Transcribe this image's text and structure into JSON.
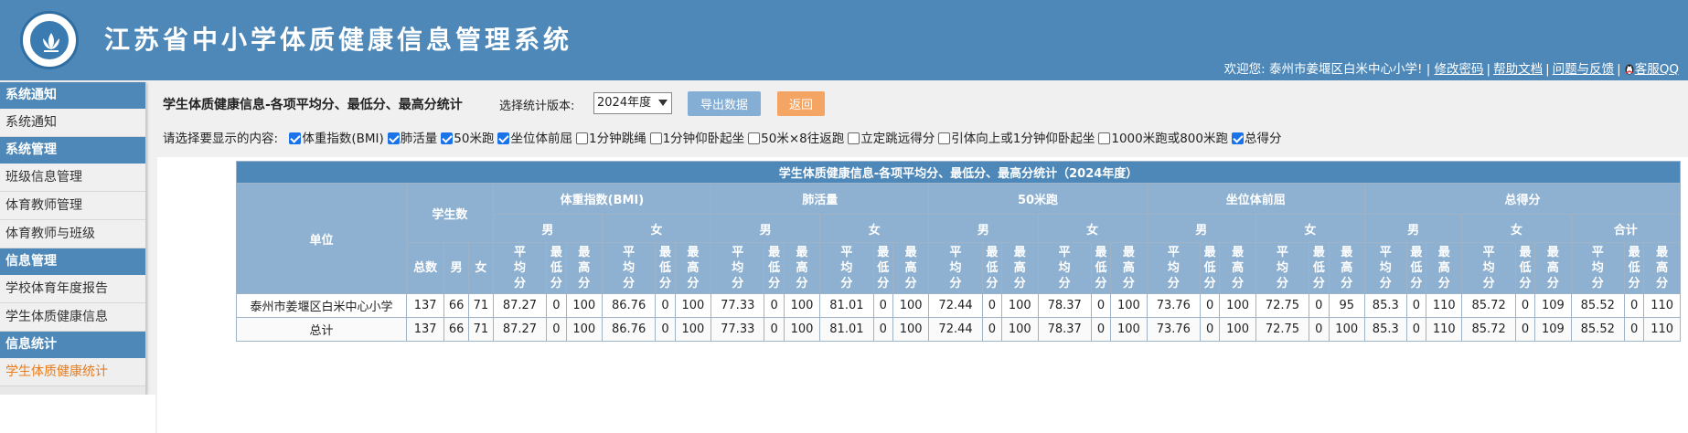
{
  "header": {
    "title": "江苏省中小学体质健康信息管理系统"
  },
  "topnav": {
    "welcome": "欢迎您: 泰州市姜堰区白米中心小学! |",
    "change_password": "修改密码",
    "help": "帮助文档",
    "feedback": "问题与反馈",
    "qq": "客服QQ"
  },
  "sidebar": [
    {
      "head": "系统通知",
      "items": [
        {
          "label": "系统通知"
        }
      ]
    },
    {
      "head": "系统管理",
      "items": [
        {
          "label": "班级信息管理"
        },
        {
          "label": "体育教师管理"
        },
        {
          "label": "体育教师与班级"
        }
      ]
    },
    {
      "head": "信息管理",
      "items": [
        {
          "label": "学校体育年度报告"
        },
        {
          "label": "学生体质健康信息"
        }
      ]
    },
    {
      "head": "信息统计",
      "items": [
        {
          "label": "学生体质健康统计",
          "active": true
        }
      ]
    }
  ],
  "toolbar": {
    "page_title": "学生体质健康信息-各项平均分、最低分、最高分统计",
    "version_label": "选择统计版本:",
    "version_value": "2024年度",
    "export_label": "导出数据",
    "back_label": "返回"
  },
  "options": {
    "label": "请选择要显示的内容:",
    "items": [
      {
        "label": "体重指数(BMI)",
        "checked": true
      },
      {
        "label": "肺活量",
        "checked": true
      },
      {
        "label": "50米跑",
        "checked": true
      },
      {
        "label": "坐位体前屈",
        "checked": true
      },
      {
        "label": "1分钟跳绳",
        "checked": false
      },
      {
        "label": "1分钟仰卧起坐",
        "checked": false
      },
      {
        "label": "50米×8往返跑",
        "checked": false
      },
      {
        "label": "立定跳远得分",
        "checked": false
      },
      {
        "label": "引体向上或1分钟仰卧起坐",
        "checked": false
      },
      {
        "label": "1000米跑或800米跑",
        "checked": false
      },
      {
        "label": "总得分",
        "checked": true
      }
    ]
  },
  "table": {
    "caption": "学生体质健康信息-各项平均分、最低分、最高分统计（2024年度）",
    "unit_header": "单位",
    "count_header": "学生数",
    "count_sub": [
      "总数",
      "男",
      "女"
    ],
    "items": [
      "体重指数(BMI)",
      "肺活量",
      "50米跑",
      "坐位体前屈"
    ],
    "total_item": "总得分",
    "male": "男",
    "female": "女",
    "combined": "合计",
    "stat_sub": [
      "平均分",
      "最低分",
      "最高分"
    ],
    "rows": [
      {
        "unit": "泰州市姜堰区白米中心小学",
        "values": [
          "137",
          "66",
          "71",
          "87.27",
          "0",
          "100",
          "86.76",
          "0",
          "100",
          "77.33",
          "0",
          "100",
          "81.01",
          "0",
          "100",
          "72.44",
          "0",
          "100",
          "78.37",
          "0",
          "100",
          "73.76",
          "0",
          "100",
          "72.75",
          "0",
          "95",
          "85.3",
          "0",
          "110",
          "85.72",
          "0",
          "109",
          "85.52",
          "0",
          "110"
        ]
      },
      {
        "unit": "总计",
        "values": [
          "137",
          "66",
          "71",
          "87.27",
          "0",
          "100",
          "86.76",
          "0",
          "100",
          "77.33",
          "0",
          "100",
          "81.01",
          "0",
          "100",
          "72.44",
          "0",
          "100",
          "78.37",
          "0",
          "100",
          "73.76",
          "0",
          "100",
          "72.75",
          "0",
          "100",
          "85.3",
          "0",
          "110",
          "85.72",
          "0",
          "109",
          "85.52",
          "0",
          "110"
        ]
      }
    ]
  }
}
